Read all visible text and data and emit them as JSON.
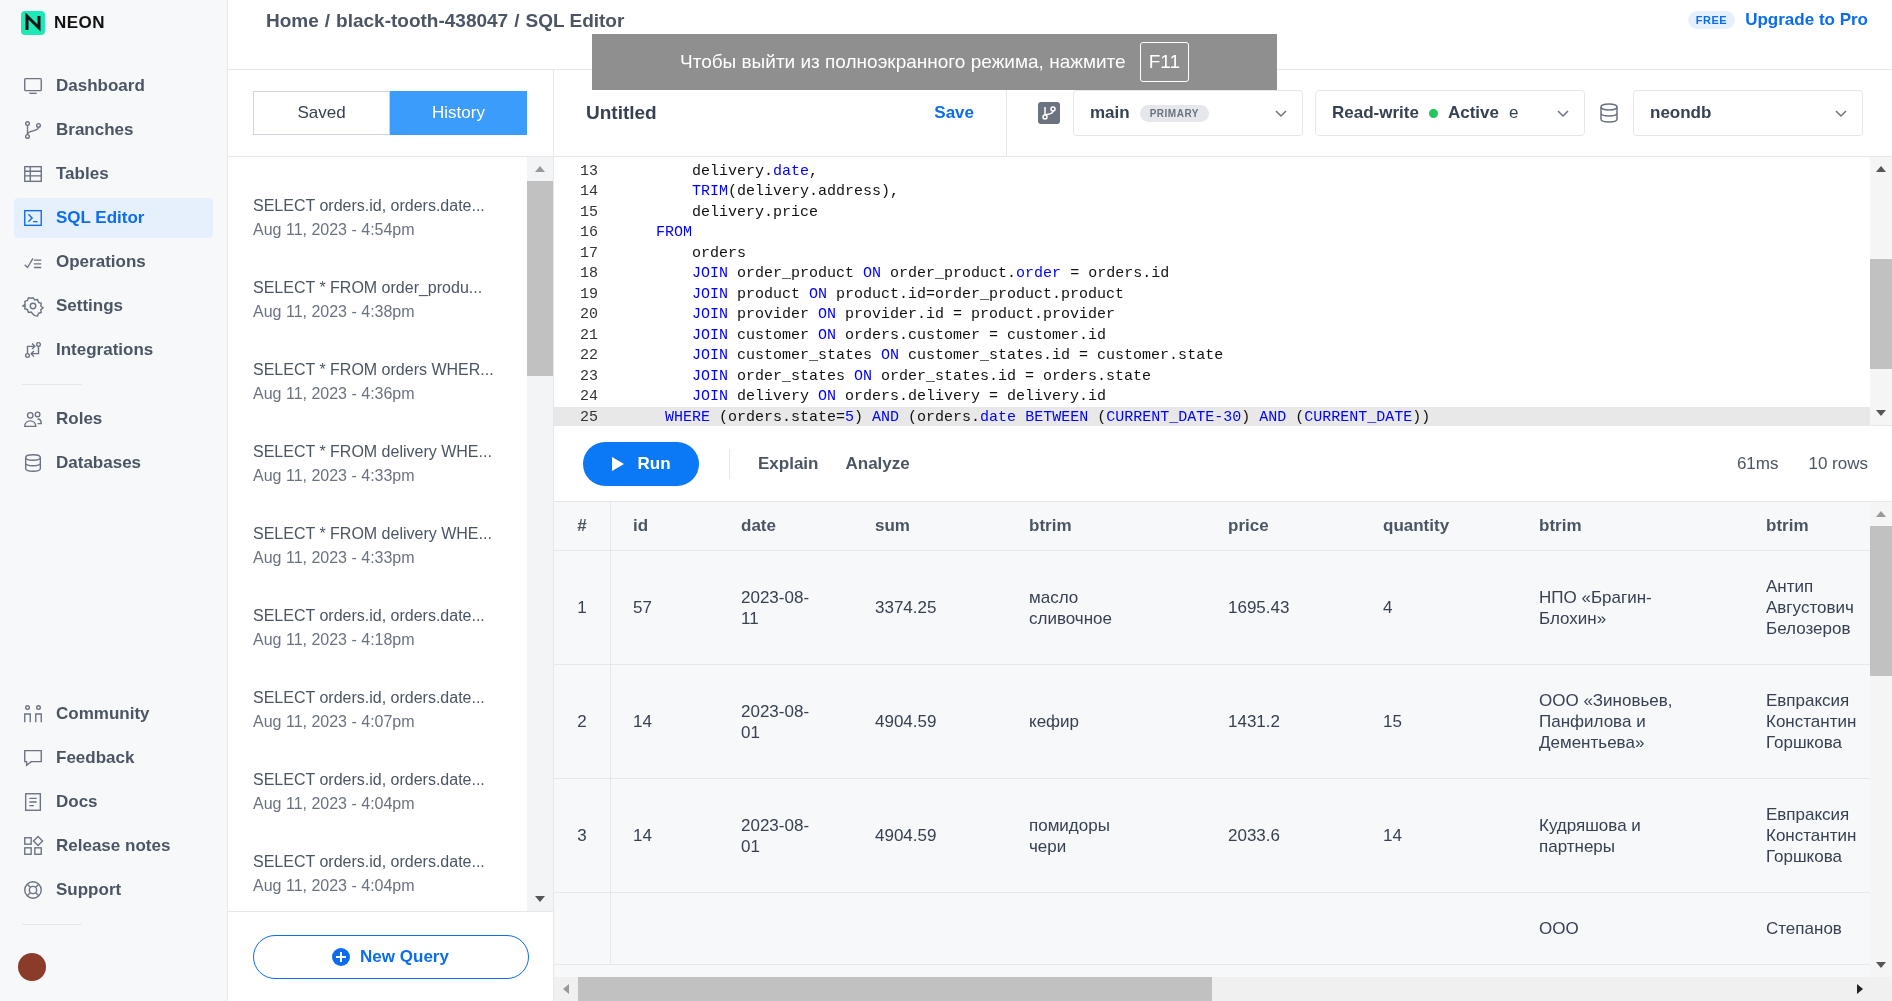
{
  "logo": {
    "text": "NEON"
  },
  "sidebar": {
    "items": [
      {
        "label": "Dashboard",
        "selected": false,
        "group_start": false
      },
      {
        "label": "Branches",
        "selected": false,
        "group_start": false
      },
      {
        "label": "Tables",
        "selected": false,
        "group_start": false
      },
      {
        "label": "SQL Editor",
        "selected": true,
        "group_start": false
      },
      {
        "label": "Operations",
        "selected": false,
        "group_start": false
      },
      {
        "label": "Settings",
        "selected": false,
        "group_start": false
      },
      {
        "label": "Integrations",
        "selected": false,
        "group_start": false
      },
      {
        "label": "Roles",
        "selected": false,
        "group_start": true
      },
      {
        "label": "Databases",
        "selected": false,
        "group_start": false
      }
    ],
    "bottom_items": [
      {
        "label": "Community"
      },
      {
        "label": "Feedback"
      },
      {
        "label": "Docs"
      },
      {
        "label": "Release notes"
      },
      {
        "label": "Support"
      }
    ]
  },
  "breadcrumb": [
    {
      "label": "Home"
    },
    {
      "separator": "/",
      "label": "black-tooth-438047"
    },
    {
      "separator": "/",
      "label": "SQL Editor"
    }
  ],
  "plan": {
    "badge": "FREE",
    "link": "Upgrade to Pro"
  },
  "fullscreen_toast": {
    "text": "Чтобы выйти из полноэкранного режима, нажмите",
    "key": "F11"
  },
  "history_tabs": [
    {
      "label": "Saved",
      "selected": false
    },
    {
      "label": "History",
      "selected": true
    }
  ],
  "history": [
    {
      "query": "SELECT orders.id, orders.date...",
      "time": "Aug 11, 2023 - 4:54pm"
    },
    {
      "query": "SELECT * FROM order_produ...",
      "time": "Aug 11, 2023 - 4:38pm"
    },
    {
      "query": "SELECT * FROM orders WHER...",
      "time": "Aug 11, 2023 - 4:36pm"
    },
    {
      "query": "SELECT * FROM delivery WHE...",
      "time": "Aug 11, 2023 - 4:33pm"
    },
    {
      "query": "SELECT * FROM delivery WHE...",
      "time": "Aug 11, 2023 - 4:33pm"
    },
    {
      "query": "SELECT orders.id, orders.date...",
      "time": "Aug 11, 2023 - 4:18pm"
    },
    {
      "query": "SELECT orders.id, orders.date...",
      "time": "Aug 11, 2023 - 4:07pm"
    },
    {
      "query": "SELECT orders.id, orders.date...",
      "time": "Aug 11, 2023 - 4:04pm"
    },
    {
      "query": "SELECT orders.id, orders.date...",
      "time": "Aug 11, 2023 - 4:04pm"
    }
  ],
  "new_query_button": "New Query",
  "editor": {
    "title": "Untitled",
    "save": "Save",
    "branch": {
      "name": "main",
      "badge": "PRIMARY"
    },
    "compute": {
      "mode": "Read-write",
      "status": "Active",
      "extra": "e"
    },
    "database": "neondb",
    "lines": [
      {
        "number": "13",
        "current": false,
        "tokens": [
          {
            "text": "        delivery.",
            "kind": "plain"
          },
          {
            "text": "date",
            "kind": "keyword"
          },
          {
            "text": ",",
            "kind": "plain"
          }
        ]
      },
      {
        "number": "14",
        "current": false,
        "tokens": [
          {
            "text": "        TRIM",
            "kind": "keyword"
          },
          {
            "text": "(delivery.address),",
            "kind": "plain"
          }
        ]
      },
      {
        "number": "15",
        "current": false,
        "tokens": [
          {
            "text": "        delivery.price",
            "kind": "plain"
          }
        ]
      },
      {
        "number": "16",
        "current": false,
        "tokens": [
          {
            "text": "    FROM",
            "kind": "keyword"
          }
        ]
      },
      {
        "number": "17",
        "current": false,
        "tokens": [
          {
            "text": "        orders",
            "kind": "plain"
          }
        ]
      },
      {
        "number": "18",
        "current": false,
        "tokens": [
          {
            "text": "        JOIN",
            "kind": "keyword"
          },
          {
            "text": " order_product ",
            "kind": "plain"
          },
          {
            "text": "ON",
            "kind": "keyword"
          },
          {
            "text": " order_product.",
            "kind": "plain"
          },
          {
            "text": "order",
            "kind": "keyword"
          },
          {
            "text": " = orders.id",
            "kind": "plain"
          }
        ]
      },
      {
        "number": "19",
        "current": false,
        "tokens": [
          {
            "text": "        JOIN",
            "kind": "keyword"
          },
          {
            "text": " product ",
            "kind": "plain"
          },
          {
            "text": "ON",
            "kind": "keyword"
          },
          {
            "text": " product.id=order_product.product",
            "kind": "plain"
          }
        ]
      },
      {
        "number": "20",
        "current": false,
        "tokens": [
          {
            "text": "        JOIN",
            "kind": "keyword"
          },
          {
            "text": " provider ",
            "kind": "plain"
          },
          {
            "text": "ON",
            "kind": "keyword"
          },
          {
            "text": " provider.id = product.provider",
            "kind": "plain"
          }
        ]
      },
      {
        "number": "21",
        "current": false,
        "tokens": [
          {
            "text": "        JOIN",
            "kind": "keyword"
          },
          {
            "text": " customer ",
            "kind": "plain"
          },
          {
            "text": "ON",
            "kind": "keyword"
          },
          {
            "text": " orders.customer = customer.id",
            "kind": "plain"
          }
        ]
      },
      {
        "number": "22",
        "current": false,
        "tokens": [
          {
            "text": "        JOIN",
            "kind": "keyword"
          },
          {
            "text": " customer_states ",
            "kind": "plain"
          },
          {
            "text": "ON",
            "kind": "keyword"
          },
          {
            "text": " customer_states.id = customer.state",
            "kind": "plain"
          }
        ]
      },
      {
        "number": "23",
        "current": false,
        "tokens": [
          {
            "text": "        JOIN",
            "kind": "keyword"
          },
          {
            "text": " order_states ",
            "kind": "plain"
          },
          {
            "text": "ON",
            "kind": "keyword"
          },
          {
            "text": " order_states.id = orders.state",
            "kind": "plain"
          }
        ]
      },
      {
        "number": "24",
        "current": false,
        "tokens": [
          {
            "text": "        JOIN",
            "kind": "keyword"
          },
          {
            "text": " delivery ",
            "kind": "plain"
          },
          {
            "text": "ON",
            "kind": "keyword"
          },
          {
            "text": " orders.delivery = delivery.id",
            "kind": "plain"
          }
        ]
      },
      {
        "number": "25",
        "current": true,
        "tokens": [
          {
            "text": "     WHERE",
            "kind": "keyword"
          },
          {
            "text": " (orders.state=",
            "kind": "plain"
          },
          {
            "text": "5",
            "kind": "keyword"
          },
          {
            "text": ") ",
            "kind": "plain"
          },
          {
            "text": "AND",
            "kind": "keyword"
          },
          {
            "text": " (orders.",
            "kind": "plain"
          },
          {
            "text": "date",
            "kind": "keyword"
          },
          {
            "text": " BETWEEN",
            "kind": "keyword"
          },
          {
            "text": " (",
            "kind": "plain"
          },
          {
            "text": "CURRENT_DATE-30",
            "kind": "keyword"
          },
          {
            "text": ") ",
            "kind": "plain"
          },
          {
            "text": "AND",
            "kind": "keyword"
          },
          {
            "text": " (",
            "kind": "plain"
          },
          {
            "text": "CURRENT_DATE",
            "kind": "keyword"
          },
          {
            "text": "))",
            "kind": "plain"
          }
        ]
      }
    ]
  },
  "run_bar": {
    "run": "Run",
    "actions": [
      "Explain",
      "Analyze"
    ],
    "duration": "61ms",
    "rows": "10 rows"
  },
  "table": {
    "columns": [
      "#",
      "id",
      "date",
      "sum",
      "btrim",
      "price",
      "quantity",
      "btrim",
      "btrim"
    ],
    "rows": [
      [
        "1",
        "57",
        "2023-08-11",
        "3374.25",
        "масло сливочное",
        "1695.43",
        "4",
        "НПО «Брагин-Блохин»",
        "Антип Августович Белозеров"
      ],
      [
        "2",
        "14",
        "2023-08-01",
        "4904.59",
        "кефир",
        "1431.2",
        "15",
        "ООО «Зиновьев, Панфилова и Дементьева»",
        "Евпраксия Константин Горшкова"
      ],
      [
        "3",
        "14",
        "2023-08-01",
        "4904.59",
        "помидоры чери",
        "2033.6",
        "14",
        "Кудряшова и партнеры",
        "Евпраксия Константин Горшкова"
      ],
      [
        null,
        null,
        null,
        null,
        null,
        null,
        null,
        "ООО",
        "Степанов"
      ]
    ]
  }
}
